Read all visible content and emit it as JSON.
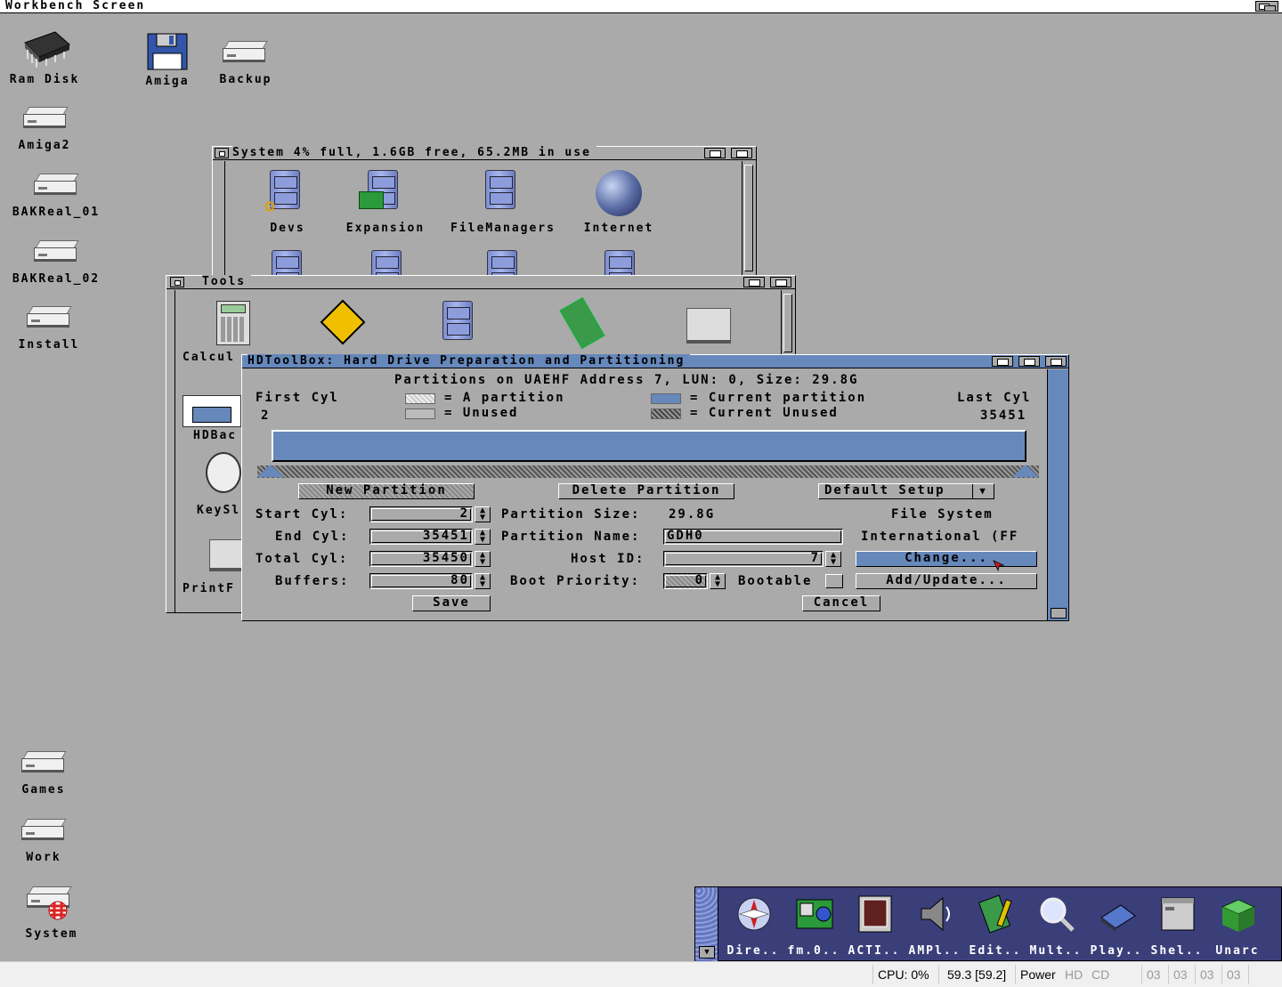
{
  "screen": {
    "title": "Workbench Screen"
  },
  "desktop_icons": [
    {
      "label": "Ram Disk"
    },
    {
      "label": "Amiga"
    },
    {
      "label": "Backup"
    },
    {
      "label": "Amiga2"
    },
    {
      "label": "BAKReal_01"
    },
    {
      "label": "BAKReal_02"
    },
    {
      "label": "Install"
    },
    {
      "label": "Games"
    },
    {
      "label": "Work"
    },
    {
      "label": "System"
    }
  ],
  "system_window": {
    "title": "System  4% full, 1.6GB free, 65.2MB in use",
    "icons": [
      {
        "label": "Devs"
      },
      {
        "label": "Expansion"
      },
      {
        "label": "FileManagers"
      },
      {
        "label": "Internet"
      }
    ]
  },
  "tools_window": {
    "title": "Tools",
    "icons": [
      {
        "label": "Calcul"
      },
      {
        "label": "HDBac"
      },
      {
        "label": "KeySl"
      },
      {
        "label": "PrintF"
      }
    ]
  },
  "hdtoolbox": {
    "title": "HDToolBox: Hard Drive Preparation and Partitioning",
    "header": "Partitions on UAEHF Address 7, LUN: 0, Size: 29.8G",
    "first_cyl_label": "First Cyl",
    "first_cyl_value": "2",
    "last_cyl_label": "Last Cyl",
    "last_cyl_value": "35451",
    "legend": {
      "a_partition": "= A partition",
      "unused": "= Unused",
      "current_partition": "= Current partition",
      "current_unused": "= Current Unused"
    },
    "buttons": {
      "new_partition": "New Partition",
      "delete_partition": "Delete Partition",
      "default_setup": "Default Setup",
      "change": "Change...",
      "add_update": "Add/Update...",
      "save": "Save",
      "cancel": "Cancel"
    },
    "fields": {
      "start_cyl_label": "Start Cyl:",
      "start_cyl": "2",
      "end_cyl_label": "End Cyl:",
      "end_cyl": "35451",
      "total_cyl_label": "Total Cyl:",
      "total_cyl": "35450",
      "buffers_label": "Buffers:",
      "buffers": "80",
      "partition_size_label": "Partition Size:",
      "partition_size": "29.8G",
      "partition_name_label": "Partition Name:",
      "partition_name": "GDH0",
      "host_id_label": "Host ID:",
      "host_id": "7",
      "boot_priority_label": "Boot Priority:",
      "boot_priority": "0",
      "bootable_label": "Bootable",
      "file_system_label": "File System",
      "file_system": "International (FF"
    },
    "colors": {
      "accent": "#6688bb",
      "window_bg": "#aaaaaa"
    }
  },
  "dock": {
    "items": [
      {
        "label": "Dire.."
      },
      {
        "label": "fm.0.."
      },
      {
        "label": "ACTI.."
      },
      {
        "label": "AMPl.."
      },
      {
        "label": "Edit.."
      },
      {
        "label": "Mult.."
      },
      {
        "label": "Play.."
      },
      {
        "label": "Shel.."
      },
      {
        "label": "Unarc"
      }
    ]
  },
  "status_bar": {
    "cpu": "CPU: 0%",
    "fps": "59.3 [59.2]",
    "power": "Power",
    "hd": "HD",
    "cd": "CD",
    "df": [
      "03",
      "03",
      "03",
      "03"
    ]
  }
}
